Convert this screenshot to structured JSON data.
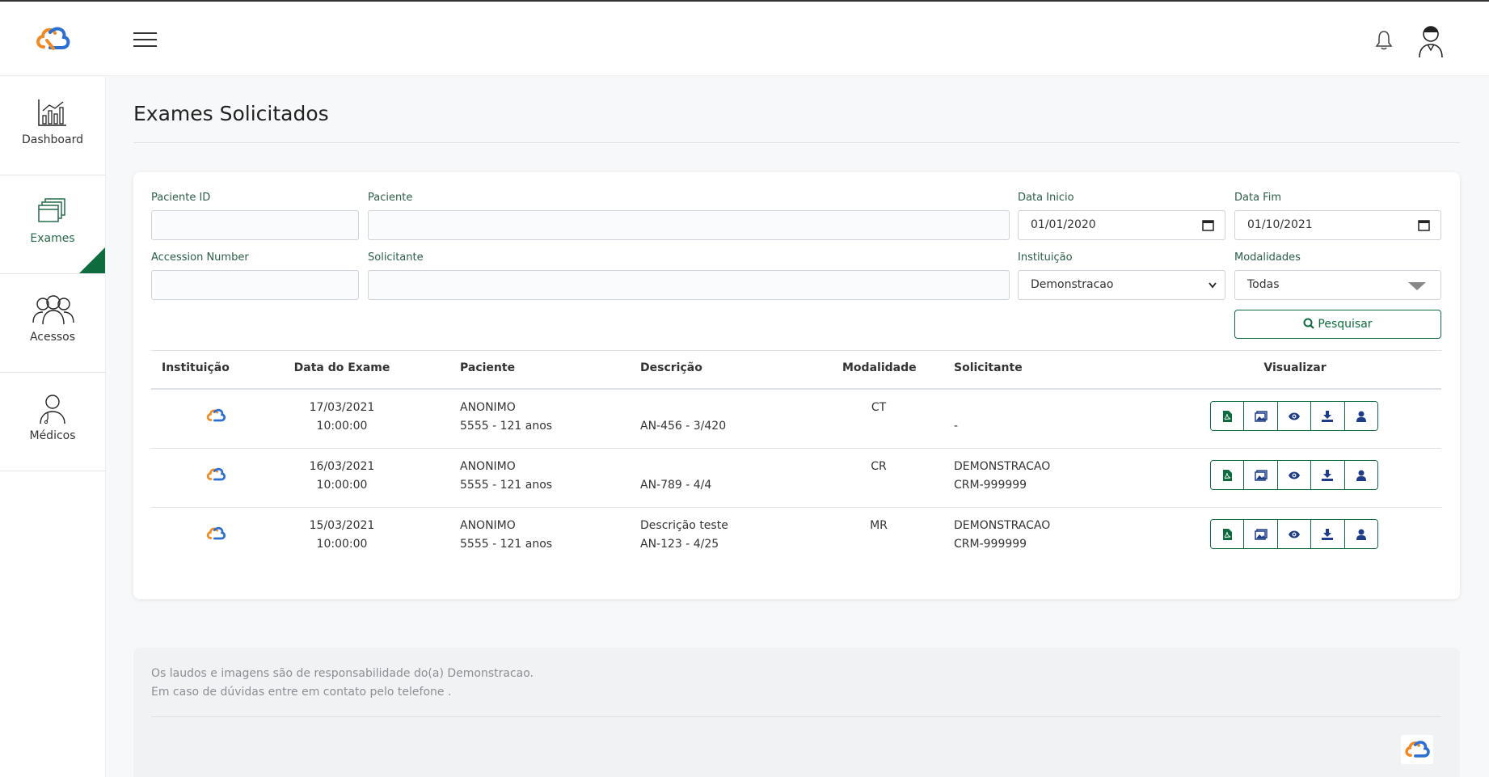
{
  "header": {
    "logo": "cloud-logo-icon",
    "menu_icon": "hamburger-icon",
    "notification_icon": "bell-icon",
    "avatar_icon": "doctor-avatar-icon"
  },
  "sidebar": {
    "items": [
      {
        "label": "Dashboard",
        "icon": "chart-icon"
      },
      {
        "label": "Exames",
        "icon": "stacked-cards-icon"
      },
      {
        "label": "Acessos",
        "icon": "users-group-icon"
      },
      {
        "label": "Médicos",
        "icon": "doctor-icon"
      }
    ]
  },
  "page": {
    "title": "Exames Solicitados"
  },
  "filters": {
    "paciente_id": {
      "label": "Paciente ID",
      "value": ""
    },
    "paciente": {
      "label": "Paciente",
      "value": ""
    },
    "data_inicio": {
      "label": "Data Inicio",
      "value": "01/01/2020"
    },
    "data_fim": {
      "label": "Data Fim",
      "value": "01/10/2021"
    },
    "accession": {
      "label": "Accession Number",
      "value": ""
    },
    "solicitante": {
      "label": "Solicitante",
      "value": ""
    },
    "instituicao": {
      "label": "Instituição",
      "value": "Demonstracao"
    },
    "modalidades": {
      "label": "Modalidades",
      "value": "Todas"
    },
    "search_label": "Pesquisar"
  },
  "table": {
    "headers": {
      "instituicao": "Instituição",
      "data": "Data do Exame",
      "paciente": "Paciente",
      "descricao": "Descrição",
      "modalidade": "Modalidade",
      "solicitante": "Solicitante",
      "visualizar": "Visualizar"
    },
    "rows": [
      {
        "date": "17/03/2021",
        "time": "10:00:00",
        "patient": "ANONIMO",
        "patient_info": "5555 - 121 anos",
        "desc1": "",
        "desc2": "AN-456 - 3/420",
        "modality": "CT",
        "req1": "",
        "req2": "-"
      },
      {
        "date": "16/03/2021",
        "time": "10:00:00",
        "patient": "ANONIMO",
        "patient_info": "5555 - 121 anos",
        "desc1": "",
        "desc2": "AN-789 - 4/4",
        "modality": "CR",
        "req1": "DEMONSTRACAO",
        "req2": "CRM-999999"
      },
      {
        "date": "15/03/2021",
        "time": "10:00:00",
        "patient": "ANONIMO",
        "patient_info": "5555 - 121 anos",
        "desc1": "Descrição teste",
        "desc2": "AN-123 - 4/25",
        "modality": "MR",
        "req1": "DEMONSTRACAO",
        "req2": "CRM-999999"
      }
    ],
    "action_icons": [
      "pdf-icon",
      "images-icon",
      "eye-icon",
      "download-icon",
      "user-icon"
    ]
  },
  "footer": {
    "line1": "Os laudos e imagens são de responsabilidade do(a) Demonstracao.",
    "line2": "Em caso de dúvidas entre em contato pelo telefone ."
  },
  "colors": {
    "accent_green": "#0e6b3e",
    "icon_blue": "#1f3c88",
    "logo_orange": "#f08a24",
    "logo_blue": "#2a6fd1"
  }
}
